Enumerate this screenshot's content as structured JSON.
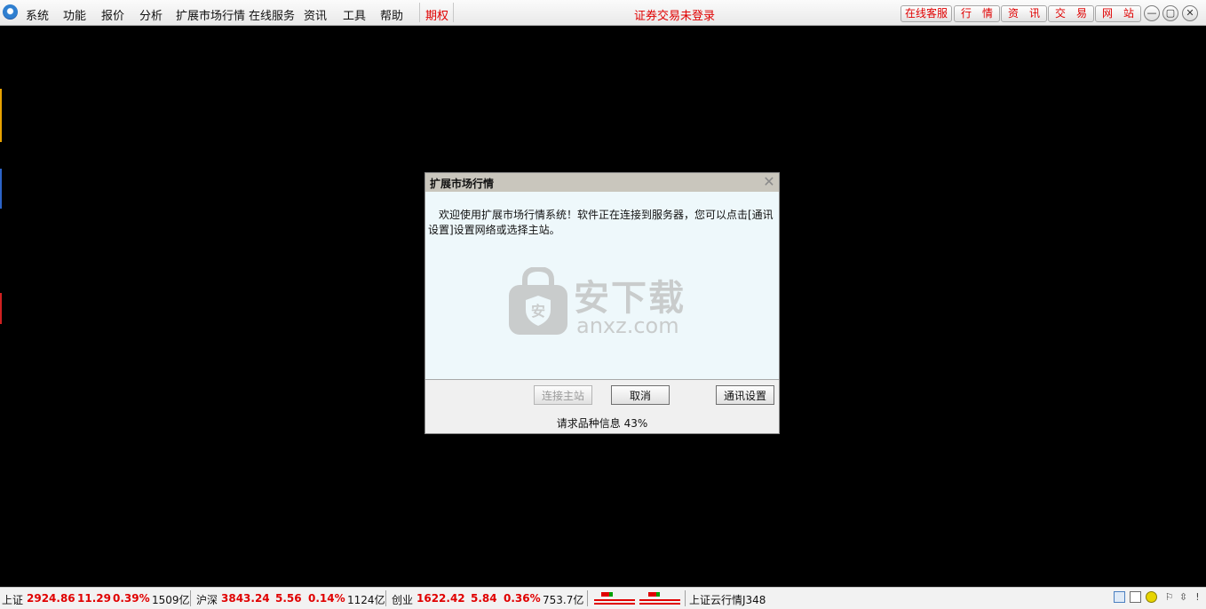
{
  "menubar": {
    "items": [
      "系统",
      "功能",
      "报价",
      "分析",
      "扩展市场行情",
      "在线服务",
      "资讯",
      "工具",
      "帮助"
    ],
    "highlight_item": "期权",
    "login_status": "证券交易未登录",
    "quick_buttons": [
      "在线客服",
      "行　情",
      "资　讯",
      "交　易",
      "网　站"
    ],
    "window_controls": [
      "—",
      "▢",
      "✕"
    ]
  },
  "dialog": {
    "title": "扩展市场行情",
    "close": "✕",
    "message": "欢迎使用扩展市场行情系统！软件正在连接到服务器，您可以点击[通讯设置]设置网络或选择主站。",
    "watermark_title": "安下载",
    "watermark_domain": "anxz.com",
    "buttons": {
      "connect": "连接主站",
      "cancel": "取消",
      "settings": "通讯设置"
    },
    "progress_text": "请求品种信息 43%",
    "progress": 0.43
  },
  "ticker": {
    "sh_name": "上证",
    "sh_index": "2924.86",
    "sh_change": "11.29",
    "sh_pct": "0.39%",
    "sh_amount": "1509亿",
    "hs_name": "沪深",
    "hs_index": "3843.24",
    "hs_change": "5.56",
    "hs_pct": "0.14%",
    "hs_amount": "1124亿",
    "cy_name": "创业",
    "cy_index": "1622.42",
    "cy_change": "5.84",
    "cy_pct": "0.36%",
    "cy_amount": "753.7亿",
    "cloud_text": "上证云行情J348"
  },
  "colors": {
    "up": "#e00000",
    "menubar_bg": "#f0f0f0",
    "dialog_body": "#eef8fb",
    "workspace": "#000000"
  }
}
